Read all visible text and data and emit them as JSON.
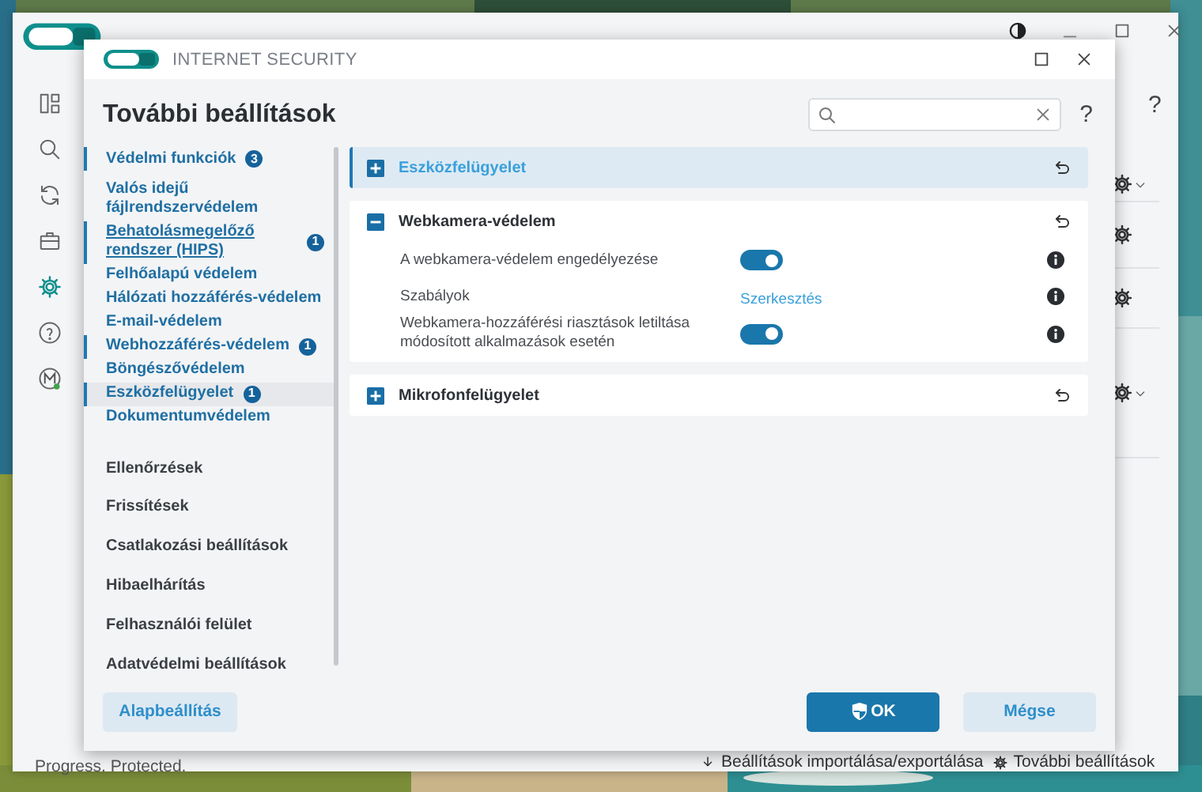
{
  "background_window": {
    "help": "?",
    "status": "Progress. Protected.",
    "footer_links": [
      {
        "kind": "import",
        "label": "Beállítások importálása/exportálása"
      },
      {
        "kind": "settings",
        "label": "További beállítások"
      }
    ]
  },
  "dialog": {
    "brand": "INTERNET SECURITY",
    "title": "További beállítások",
    "help": "?",
    "nav": [
      {
        "label": "Védelmi funkciók",
        "badge": "3",
        "modified": true,
        "selected": false,
        "hovered": false,
        "children": [
          {
            "label": "Valós idejű fájlrendszervédelem",
            "modified": false,
            "selected": false,
            "hovered": false
          },
          {
            "label": "Behatolásmegelőző rendszer (HIPS)",
            "badge": "1",
            "modified": true,
            "selected": false,
            "hovered": true
          },
          {
            "label": "Felhőalapú védelem",
            "modified": false,
            "selected": false,
            "hovered": false
          },
          {
            "label": "Hálózati hozzáférés-védelem",
            "modified": false,
            "selected": false,
            "hovered": false
          },
          {
            "label": "E-mail-védelem",
            "modified": false,
            "selected": false,
            "hovered": false
          },
          {
            "label": "Webhozzáférés-védelem",
            "badge": "1",
            "modified": true,
            "selected": false,
            "hovered": false
          },
          {
            "label": "Böngészővédelem",
            "modified": false,
            "selected": false,
            "hovered": false
          },
          {
            "label": "Eszközfelügyelet",
            "badge": "1",
            "modified": true,
            "selected": true,
            "hovered": false
          },
          {
            "label": "Dokumentumvédelem",
            "modified": false,
            "selected": false,
            "hovered": false
          }
        ]
      },
      {
        "label": "Ellenőrzések",
        "modified": false,
        "selected": false,
        "hovered": false
      },
      {
        "label": "Frissítések",
        "modified": false,
        "selected": false,
        "hovered": false
      },
      {
        "label": "Csatlakozási beállítások",
        "modified": false,
        "selected": false,
        "hovered": false
      },
      {
        "label": "Hibaelhárítás",
        "modified": false,
        "selected": false,
        "hovered": false
      },
      {
        "label": "Felhasználói felület",
        "modified": false,
        "selected": false,
        "hovered": false
      },
      {
        "label": "Adatvédelmi beállítások",
        "modified": false,
        "selected": false,
        "hovered": false
      }
    ],
    "sections": [
      {
        "title": "Eszközfelügyelet",
        "expanded": false,
        "highlighted": true
      },
      {
        "title": "Webkamera-védelem",
        "expanded": true,
        "highlighted": false,
        "rows": [
          {
            "kind": "toggle",
            "label": "A webkamera-védelem engedélyezése",
            "on": true
          },
          {
            "kind": "link",
            "label": "Szabályok",
            "link": "Szerkesztés"
          },
          {
            "kind": "toggle",
            "label": "Webkamera-hozzáférési riasztások letiltása módosított alkalmazások esetén",
            "on": true
          }
        ]
      },
      {
        "title": "Mikrofonfelügyelet",
        "expanded": false,
        "highlighted": false
      }
    ],
    "buttons": [
      {
        "kind": "default",
        "label": "Alapbeállítás"
      },
      {
        "kind": "ok",
        "label": "OK"
      },
      {
        "kind": "cancel",
        "label": "Mégse"
      }
    ]
  }
}
